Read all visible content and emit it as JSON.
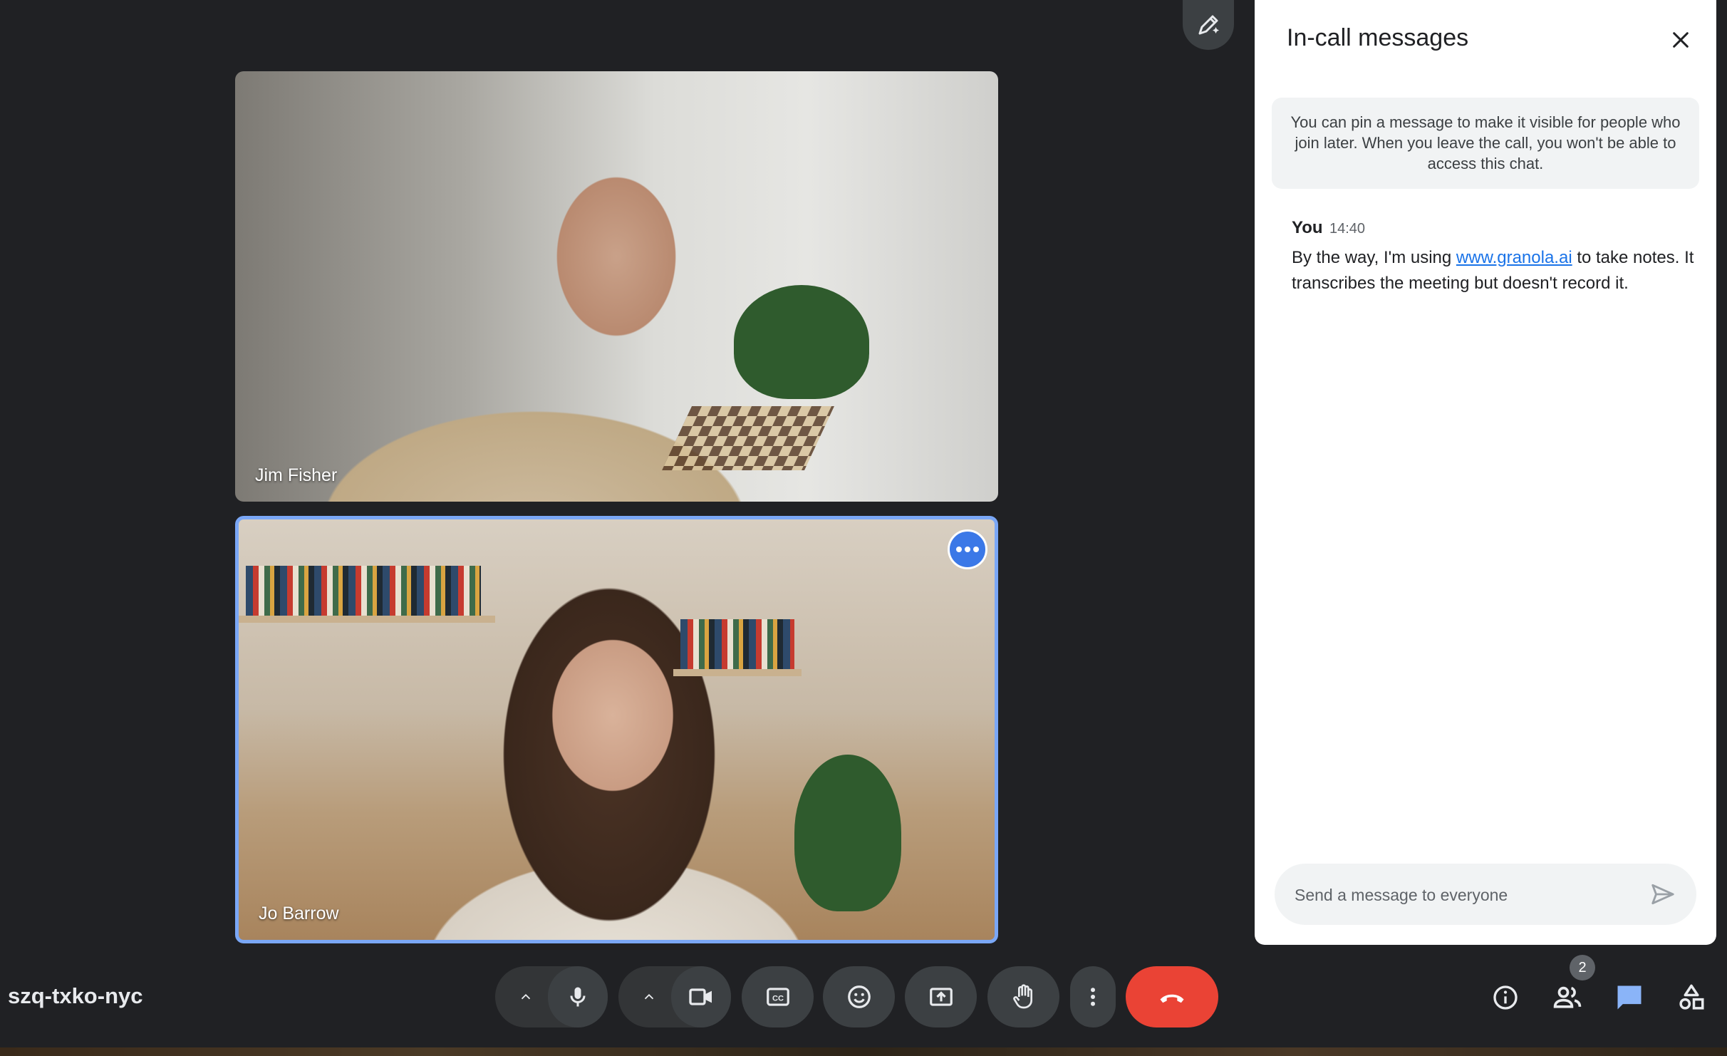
{
  "meeting": {
    "code": "szq-txko-nyc"
  },
  "participants": [
    {
      "name": "Jim Fisher"
    },
    {
      "name": "Jo Barrow"
    }
  ],
  "chat": {
    "title": "In-call messages",
    "info": "You can pin a message to make it visible for people who join later. When you leave the call, you won't be able to access this chat.",
    "messages": [
      {
        "sender": "You",
        "time": "14:40",
        "text_before": "By the way, I'm using ",
        "link": "www.granola.ai",
        "text_after": " to take notes. It transcribes the meeting but doesn't record it."
      }
    ],
    "input_placeholder": "Send a message to everyone"
  },
  "toolbar": {
    "people_count": "2",
    "accent_colors": {
      "end_call": "#ea4335",
      "active_tile_border": "#7aa7f6",
      "chat_active": "#8ab4f8"
    }
  },
  "icons": [
    "pen-sparkle-icon",
    "close-icon",
    "send-icon",
    "chevron-up-icon",
    "microphone-icon",
    "video-camera-icon",
    "closed-captions-icon",
    "emoji-icon",
    "present-screen-icon",
    "raise-hand-icon",
    "more-vert-icon",
    "end-call-icon",
    "info-icon",
    "people-icon",
    "chat-icon",
    "activities-icon"
  ]
}
